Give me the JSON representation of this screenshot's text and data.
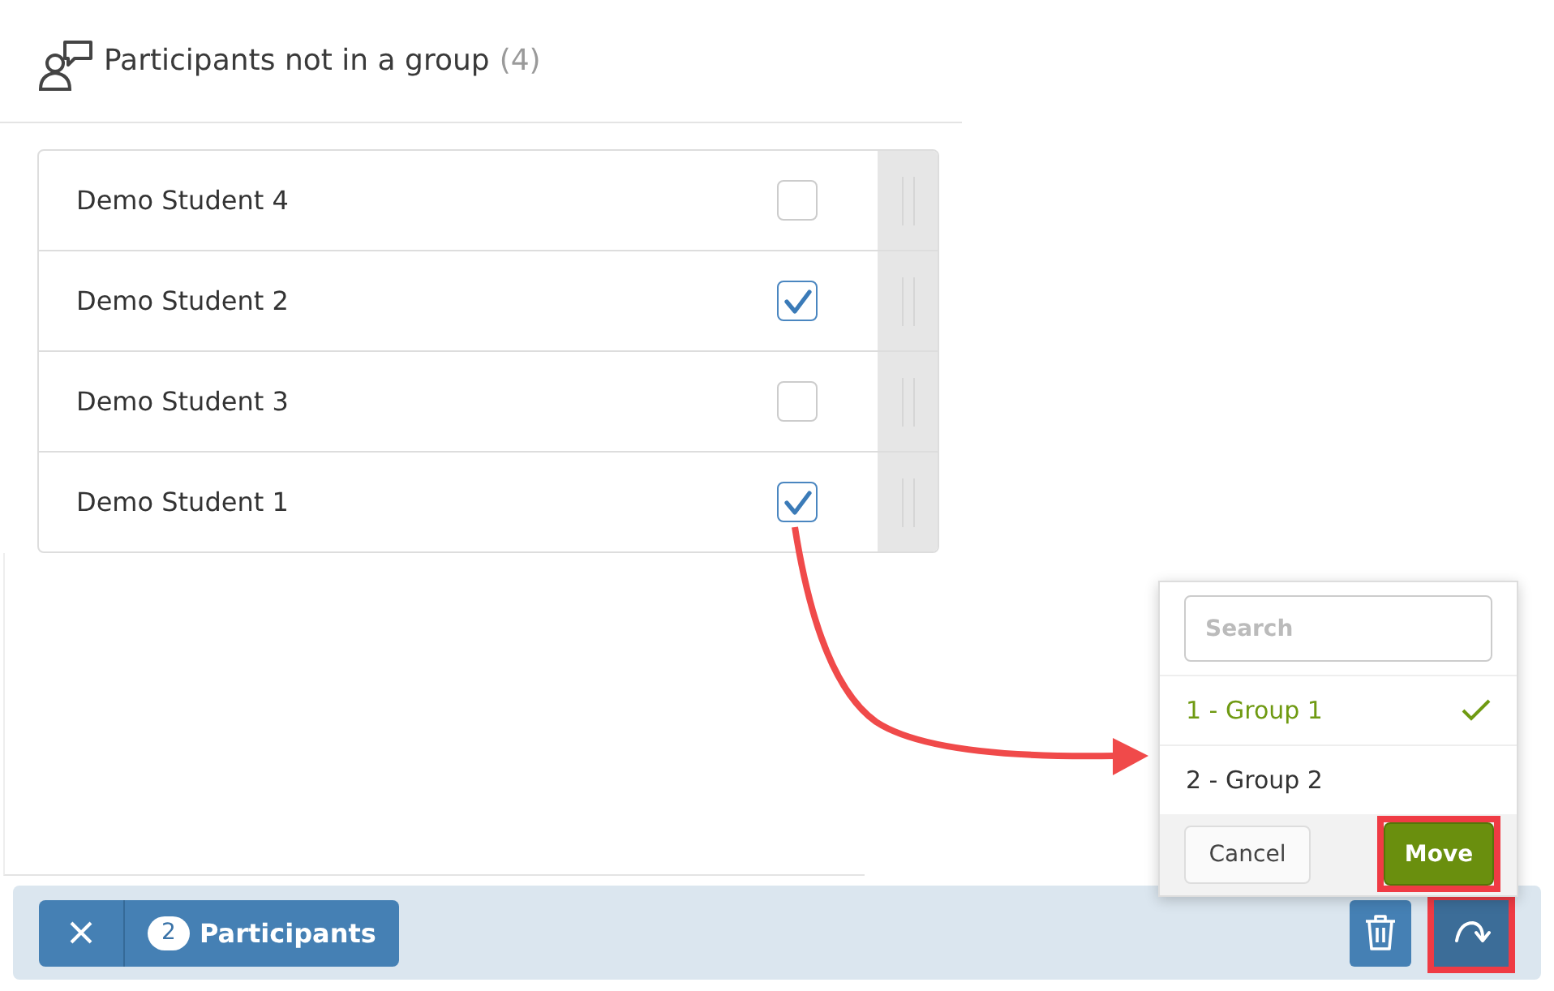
{
  "header": {
    "title": "Participants not in a group",
    "count": "(4)"
  },
  "participants": [
    {
      "name": "Demo Student 4",
      "checked": false
    },
    {
      "name": "Demo Student 2",
      "checked": true
    },
    {
      "name": "Demo Student 3",
      "checked": false
    },
    {
      "name": "Demo Student 1",
      "checked": true
    }
  ],
  "move_popup": {
    "search": {
      "placeholder": "Search"
    },
    "groups": [
      {
        "label": "1 - Group 1",
        "selected": true
      },
      {
        "label": "2 - Group 2",
        "selected": false
      }
    ],
    "cancel": "Cancel",
    "move": {
      "label": "Move",
      "highlighted": true
    }
  },
  "selection_bar": {
    "count": "2",
    "label": "Participants",
    "redo_highlighted": true
  }
}
